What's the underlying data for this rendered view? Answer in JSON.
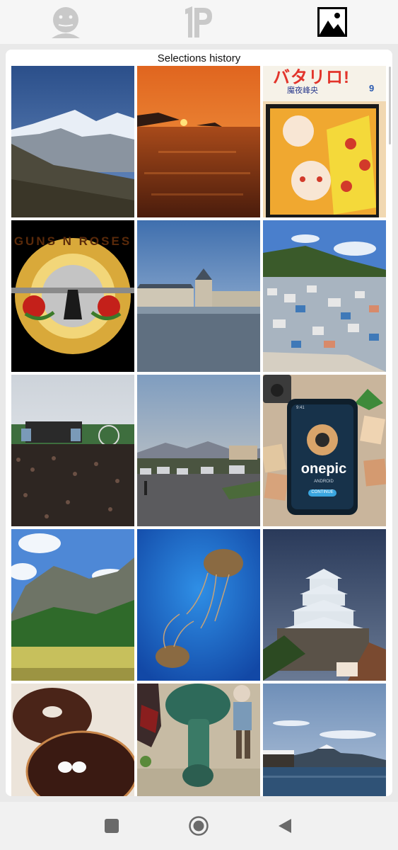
{
  "tabs": [
    {
      "name": "face",
      "icon": "face-icon"
    },
    {
      "name": "logo",
      "icon": "p-logo-icon"
    },
    {
      "name": "gallery",
      "icon": "image-icon"
    }
  ],
  "active_tab": "gallery",
  "history": {
    "title": "Selections history",
    "items": [
      {
        "subject": "snowy mountain peaks"
      },
      {
        "subject": "sunset over the sea"
      },
      {
        "subject": "manga magazine cover",
        "text_top": "バタリロ!",
        "text_author": "魔夜峰央",
        "text_number": "9"
      },
      {
        "subject": "band logo",
        "text": "GUNS N ROSES"
      },
      {
        "subject": "château by a lake"
      },
      {
        "subject": "hillside colorful village"
      },
      {
        "subject": "concert crowd"
      },
      {
        "subject": "parking lot at dusk"
      },
      {
        "subject": "phone app mockup",
        "app_name": "onepic",
        "app_sub": "ANDROID",
        "app_button": "CONTINUE",
        "time": "9:41"
      },
      {
        "subject": "rocky mountain and rice field"
      },
      {
        "subject": "jellyfish"
      },
      {
        "subject": "japanese castle"
      },
      {
        "subject": "donuts"
      },
      {
        "subject": "figurines"
      },
      {
        "subject": "mountain by lake with boathouse"
      }
    ]
  },
  "colors": {
    "accent": "#000000",
    "icon_inactive": "#c9c9c9",
    "card_bg": "#ffffff",
    "page_bg": "#e9e9e9"
  },
  "navigation": [
    {
      "name": "recent-apps",
      "icon": "square-icon"
    },
    {
      "name": "home",
      "icon": "circle-icon"
    },
    {
      "name": "back",
      "icon": "back-triangle-icon"
    }
  ]
}
